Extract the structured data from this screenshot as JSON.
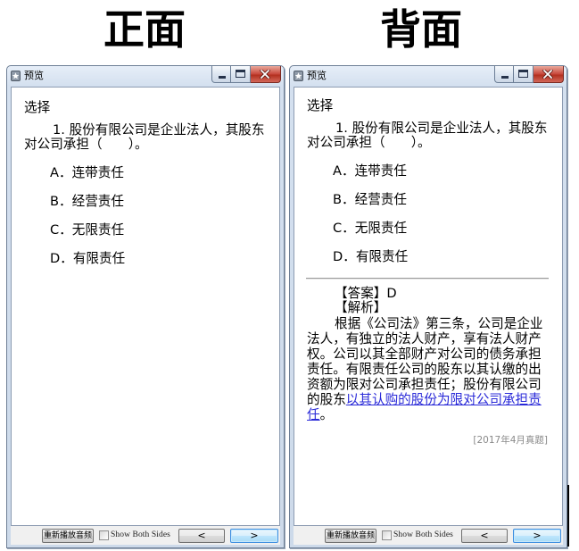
{
  "side_labels": {
    "front": "正面",
    "back": "背面"
  },
  "window": {
    "title": "预览"
  },
  "question": {
    "type": "选择",
    "stem": [
      "1. 股份有限公司是企业法人，其股东",
      "对公司承担（　　）。"
    ],
    "options": [
      "A．连带责任",
      "B．经营责任",
      "C．无限责任",
      "D．有限责任"
    ]
  },
  "answer": {
    "answer_label": "【答案】D",
    "analysis_label": "【解析】",
    "analysis_lines": [
      "根据《公司法》第三条，公司是企业",
      "法人，有独立的法人财产，享有法人财产",
      "权。公司以其全部财产对公司的债务承担",
      "责任。有限责任公司的股东以其认缴的出",
      "资额为限对公司承担责任；股份有限公司"
    ],
    "line6": {
      "plain": "的股东",
      "link": "以其认购的股份为限对公司承担责"
    },
    "line7": {
      "link": "任",
      "plain": "。"
    },
    "source": "[2017年4月真题]"
  },
  "footer": {
    "replay_label": "重新播放音频",
    "show_both_sides_label": "Show Both Sides",
    "show_both_sides_checked": false,
    "prev_label": "<",
    "next_label": ">"
  },
  "colors": {
    "link": "#2a2ad8",
    "source_text": "#8a8a8a",
    "close_button": "#c7473b",
    "focus_border": "#3d8ee0"
  },
  "icons": {
    "app": "app-icon",
    "minimize": "minimize-icon",
    "maximize": "maximize-icon",
    "close": "close-icon"
  }
}
